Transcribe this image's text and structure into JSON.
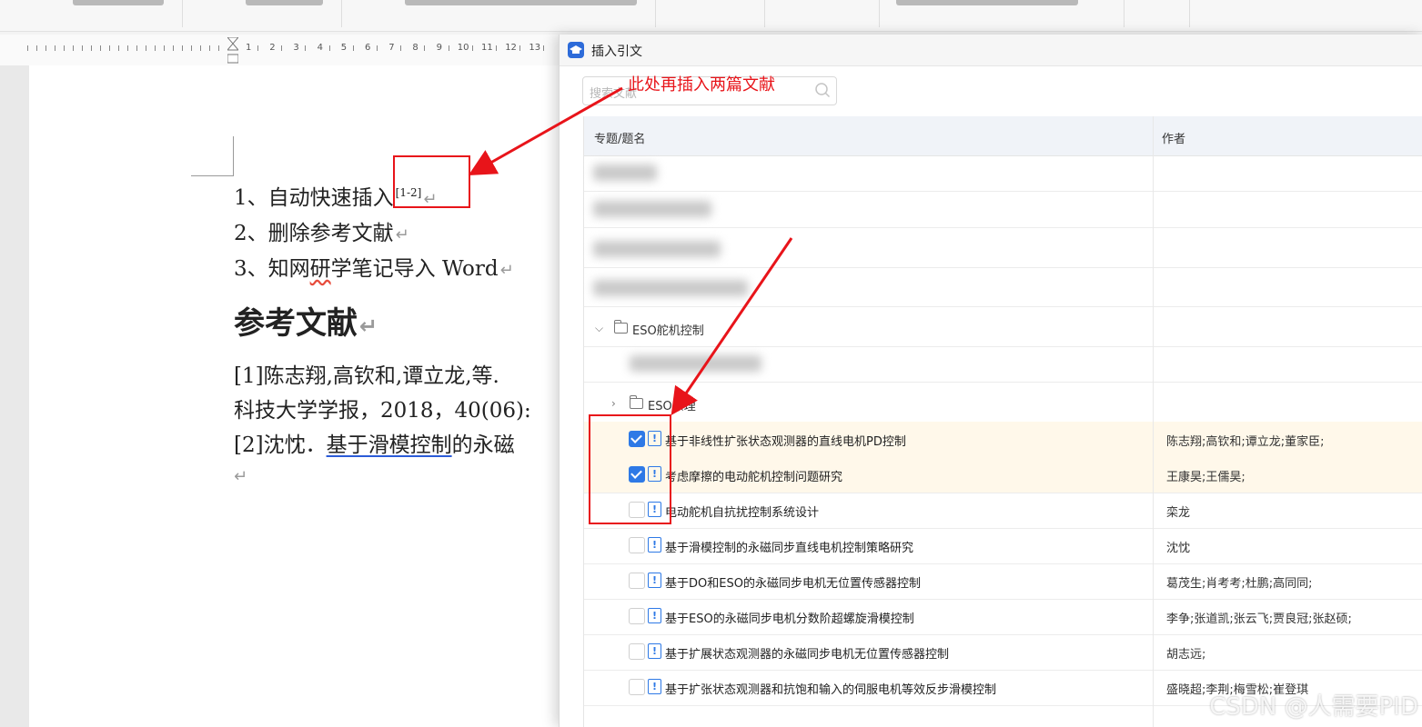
{
  "document": {
    "list_items": [
      {
        "text": "1、自动快速插入",
        "citation": "[1-2]"
      },
      {
        "text": "2、删除参考文献"
      },
      {
        "text": "3、知网",
        "squiggle": "研",
        "rest": "学笔记导入 Word"
      }
    ],
    "heading": "参考文献",
    "references": [
      "[1]陈志翔,高钦和,谭立龙,等.",
      "科技大学学报，2018，40(06):",
      {
        "prefix": "[2]沈忱．",
        "link": "基于滑模控制",
        "suffix": "的永磁"
      }
    ],
    "paragraph_mark": "↵"
  },
  "annotation": {
    "text": "此处再插入两篇文献",
    "color": "#e8141a"
  },
  "dialog": {
    "title": "插入引文",
    "search_placeholder": "搜索文献",
    "columns": {
      "title": "专题/题名",
      "author": "作者"
    },
    "group_1": "ESO舵机控制",
    "group_2": "ESO原理",
    "rows": [
      {
        "title": "基于非线性扩张状态观测器的直线电机PD控制",
        "author": "陈志翔;高钦和;谭立龙;董家臣;",
        "checked": true
      },
      {
        "title": "考虑摩擦的电动舵机控制问题研究",
        "author": "王康昊;王儒昊;",
        "checked": true
      },
      {
        "title": "电动舵机自抗扰控制系统设计",
        "author": "栾龙",
        "checked": false
      },
      {
        "title": "基于滑模控制的永磁同步直线电机控制策略研究",
        "author": "沈忱",
        "checked": false
      },
      {
        "title": "基于DO和ESO的永磁同步电机无位置传感器控制",
        "author": "葛茂生;肖考考;杜鹏;高同同;",
        "checked": false
      },
      {
        "title": "基于ESO的永磁同步电机分数阶超螺旋滑模控制",
        "author": "李争;张道凯;张云飞;贾良冠;张赵硕;",
        "checked": false
      },
      {
        "title": "基于扩展状态观测器的永磁同步电机无位置传感器控制",
        "author": "胡志远;",
        "checked": false
      },
      {
        "title": "基于扩张状态观测器和抗饱和输入的伺服电机等效反步滑模控制",
        "author": "盛晓超;李荆;梅雪松;崔登琪",
        "checked": false
      }
    ],
    "accent_color": "#2e79e6"
  },
  "watermark": "CSDN @人需要PID"
}
